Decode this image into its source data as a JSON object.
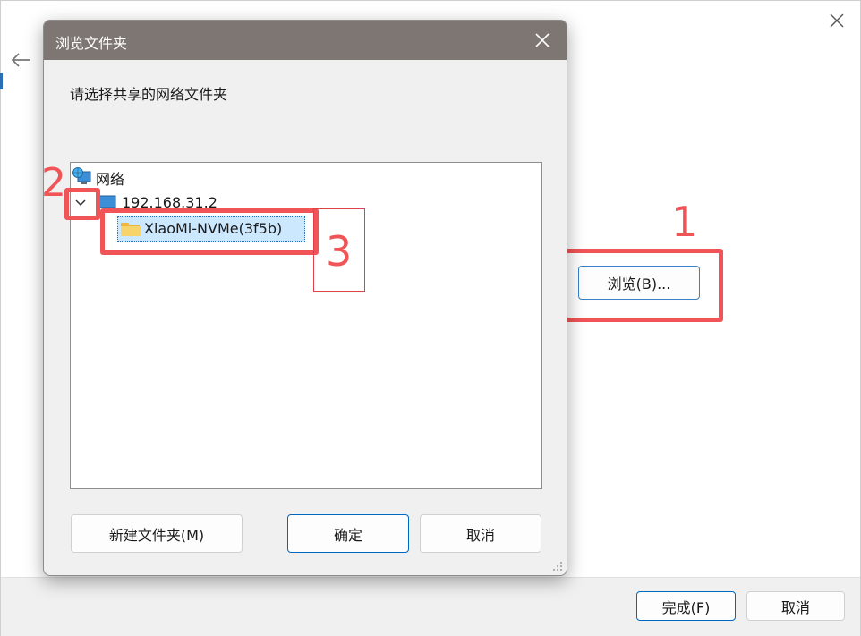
{
  "background_window": {
    "buttons": {
      "browse_label": "浏览(B)...",
      "finish_label": "完成(F)",
      "cancel_label": "取消"
    }
  },
  "dialog": {
    "title": "浏览文件夹",
    "prompt": "请选择共享的网络文件夹",
    "tree": [
      {
        "label": "网络",
        "icon": "network-icon"
      },
      {
        "label": "192.168.31.2",
        "icon": "computer-icon",
        "expanded": true
      },
      {
        "label": "XiaoMi-NVMe(3f5b)",
        "icon": "folder-icon",
        "selected": true
      }
    ],
    "buttons": {
      "new_folder_label": "新建文件夹(M)",
      "ok_label": "确定",
      "cancel_label": "取消"
    }
  },
  "annotations": {
    "label_1": "1",
    "label_2": "2",
    "label_3": "3",
    "color": "#f05457"
  }
}
